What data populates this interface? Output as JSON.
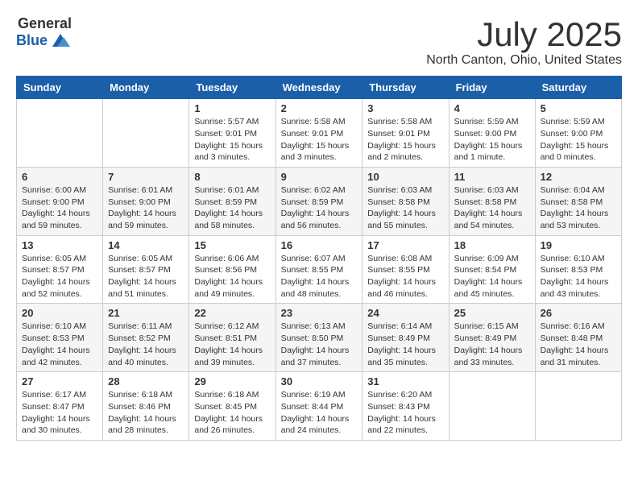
{
  "logo": {
    "general": "General",
    "blue": "Blue"
  },
  "title": "July 2025",
  "subtitle": "North Canton, Ohio, United States",
  "days_header": [
    "Sunday",
    "Monday",
    "Tuesday",
    "Wednesday",
    "Thursday",
    "Friday",
    "Saturday"
  ],
  "weeks": [
    [
      {
        "day": "",
        "info": ""
      },
      {
        "day": "",
        "info": ""
      },
      {
        "day": "1",
        "info": "Sunrise: 5:57 AM\nSunset: 9:01 PM\nDaylight: 15 hours\nand 3 minutes."
      },
      {
        "day": "2",
        "info": "Sunrise: 5:58 AM\nSunset: 9:01 PM\nDaylight: 15 hours\nand 3 minutes."
      },
      {
        "day": "3",
        "info": "Sunrise: 5:58 AM\nSunset: 9:01 PM\nDaylight: 15 hours\nand 2 minutes."
      },
      {
        "day": "4",
        "info": "Sunrise: 5:59 AM\nSunset: 9:00 PM\nDaylight: 15 hours\nand 1 minute."
      },
      {
        "day": "5",
        "info": "Sunrise: 5:59 AM\nSunset: 9:00 PM\nDaylight: 15 hours\nand 0 minutes."
      }
    ],
    [
      {
        "day": "6",
        "info": "Sunrise: 6:00 AM\nSunset: 9:00 PM\nDaylight: 14 hours\nand 59 minutes."
      },
      {
        "day": "7",
        "info": "Sunrise: 6:01 AM\nSunset: 9:00 PM\nDaylight: 14 hours\nand 59 minutes."
      },
      {
        "day": "8",
        "info": "Sunrise: 6:01 AM\nSunset: 8:59 PM\nDaylight: 14 hours\nand 58 minutes."
      },
      {
        "day": "9",
        "info": "Sunrise: 6:02 AM\nSunset: 8:59 PM\nDaylight: 14 hours\nand 56 minutes."
      },
      {
        "day": "10",
        "info": "Sunrise: 6:03 AM\nSunset: 8:58 PM\nDaylight: 14 hours\nand 55 minutes."
      },
      {
        "day": "11",
        "info": "Sunrise: 6:03 AM\nSunset: 8:58 PM\nDaylight: 14 hours\nand 54 minutes."
      },
      {
        "day": "12",
        "info": "Sunrise: 6:04 AM\nSunset: 8:58 PM\nDaylight: 14 hours\nand 53 minutes."
      }
    ],
    [
      {
        "day": "13",
        "info": "Sunrise: 6:05 AM\nSunset: 8:57 PM\nDaylight: 14 hours\nand 52 minutes."
      },
      {
        "day": "14",
        "info": "Sunrise: 6:05 AM\nSunset: 8:57 PM\nDaylight: 14 hours\nand 51 minutes."
      },
      {
        "day": "15",
        "info": "Sunrise: 6:06 AM\nSunset: 8:56 PM\nDaylight: 14 hours\nand 49 minutes."
      },
      {
        "day": "16",
        "info": "Sunrise: 6:07 AM\nSunset: 8:55 PM\nDaylight: 14 hours\nand 48 minutes."
      },
      {
        "day": "17",
        "info": "Sunrise: 6:08 AM\nSunset: 8:55 PM\nDaylight: 14 hours\nand 46 minutes."
      },
      {
        "day": "18",
        "info": "Sunrise: 6:09 AM\nSunset: 8:54 PM\nDaylight: 14 hours\nand 45 minutes."
      },
      {
        "day": "19",
        "info": "Sunrise: 6:10 AM\nSunset: 8:53 PM\nDaylight: 14 hours\nand 43 minutes."
      }
    ],
    [
      {
        "day": "20",
        "info": "Sunrise: 6:10 AM\nSunset: 8:53 PM\nDaylight: 14 hours\nand 42 minutes."
      },
      {
        "day": "21",
        "info": "Sunrise: 6:11 AM\nSunset: 8:52 PM\nDaylight: 14 hours\nand 40 minutes."
      },
      {
        "day": "22",
        "info": "Sunrise: 6:12 AM\nSunset: 8:51 PM\nDaylight: 14 hours\nand 39 minutes."
      },
      {
        "day": "23",
        "info": "Sunrise: 6:13 AM\nSunset: 8:50 PM\nDaylight: 14 hours\nand 37 minutes."
      },
      {
        "day": "24",
        "info": "Sunrise: 6:14 AM\nSunset: 8:49 PM\nDaylight: 14 hours\nand 35 minutes."
      },
      {
        "day": "25",
        "info": "Sunrise: 6:15 AM\nSunset: 8:49 PM\nDaylight: 14 hours\nand 33 minutes."
      },
      {
        "day": "26",
        "info": "Sunrise: 6:16 AM\nSunset: 8:48 PM\nDaylight: 14 hours\nand 31 minutes."
      }
    ],
    [
      {
        "day": "27",
        "info": "Sunrise: 6:17 AM\nSunset: 8:47 PM\nDaylight: 14 hours\nand 30 minutes."
      },
      {
        "day": "28",
        "info": "Sunrise: 6:18 AM\nSunset: 8:46 PM\nDaylight: 14 hours\nand 28 minutes."
      },
      {
        "day": "29",
        "info": "Sunrise: 6:18 AM\nSunset: 8:45 PM\nDaylight: 14 hours\nand 26 minutes."
      },
      {
        "day": "30",
        "info": "Sunrise: 6:19 AM\nSunset: 8:44 PM\nDaylight: 14 hours\nand 24 minutes."
      },
      {
        "day": "31",
        "info": "Sunrise: 6:20 AM\nSunset: 8:43 PM\nDaylight: 14 hours\nand 22 minutes."
      },
      {
        "day": "",
        "info": ""
      },
      {
        "day": "",
        "info": ""
      }
    ]
  ]
}
